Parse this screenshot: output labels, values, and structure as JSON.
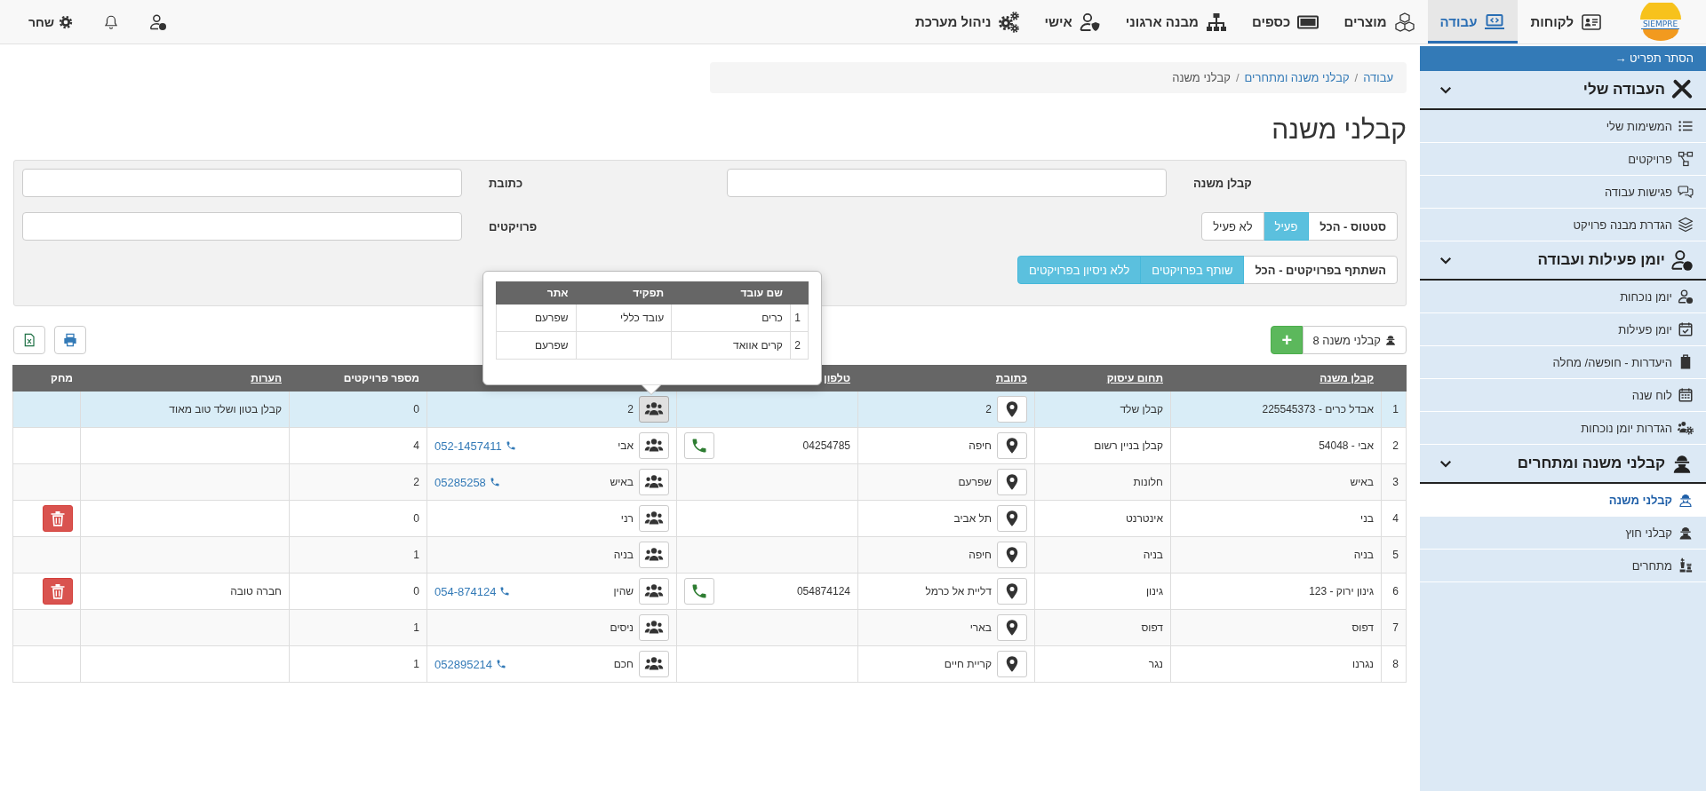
{
  "topbar": {
    "logo": "SIEMPRE",
    "nav": [
      {
        "label": "לקוחות",
        "selected": false
      },
      {
        "label": "עבודה",
        "selected": true
      },
      {
        "label": "מוצרים",
        "selected": false
      },
      {
        "label": "כספים",
        "selected": false
      },
      {
        "label": "מבנה ארגוני",
        "selected": false
      },
      {
        "label": "אישי",
        "selected": false
      },
      {
        "label": "ניהול מערכת",
        "selected": false
      }
    ],
    "user": "שחר"
  },
  "sidebar": {
    "hide_menu": "הסתר תפריט →",
    "groups": [
      {
        "title": "העבודה שלי",
        "expanded": true,
        "items": [
          {
            "label": "המשימות שלי",
            "selected": false
          },
          {
            "label": "פרויקטים",
            "selected": false
          },
          {
            "label": "פגישות עבודה",
            "selected": false
          },
          {
            "label": "הגדרת מבנה פרויקט",
            "selected": false
          }
        ]
      },
      {
        "title": "יומן פעילות ועבודה",
        "expanded": true,
        "items": [
          {
            "label": "יומן נוכחות",
            "selected": false
          },
          {
            "label": "יומן פעילות",
            "selected": false
          },
          {
            "label": "היעדרות - חופשה/ מחלה",
            "selected": false
          },
          {
            "label": "לוח שנה",
            "selected": false
          },
          {
            "label": "הגדרות יומן נוכחות",
            "selected": false
          }
        ]
      },
      {
        "title": "קבלני משנה ומתחרים",
        "expanded": true,
        "items": [
          {
            "label": "קבלני משנה",
            "selected": true
          },
          {
            "label": "קבלני חוץ",
            "selected": false
          },
          {
            "label": "מתחרים",
            "selected": false
          }
        ]
      }
    ]
  },
  "breadcrumb": {
    "separator": "/",
    "items": [
      {
        "label": "עבודה",
        "current": false
      },
      {
        "label": "קבלני משנה ומתחרים",
        "current": false
      },
      {
        "label": "קבלני משנה",
        "current": true
      }
    ]
  },
  "title": "קבלני משנה",
  "filters": {
    "fields": [
      {
        "label": "קבלן משנה"
      },
      {
        "label": "כתובת"
      },
      {
        "label": "פרויקטים"
      }
    ],
    "status": {
      "label": "סטטוס - הכל",
      "options": [
        {
          "label": "פעיל",
          "selected": true
        },
        {
          "label": "לא פעיל",
          "selected": false
        }
      ]
    },
    "participation": {
      "label": "השתתף בפרויקטים - הכל",
      "options": [
        {
          "label": "שותף בפרויקטים",
          "selected": true
        },
        {
          "label": "ללא ניסיון בפרויקטים",
          "selected": true
        }
      ]
    }
  },
  "toolbar": {
    "count": "קבלני משנה 8",
    "add": "+"
  },
  "table": {
    "columns": [
      {
        "label": "קבלן משנה",
        "sortable": true
      },
      {
        "label": "תחום עיסוק",
        "sortable": true
      },
      {
        "label": "כתובת",
        "sortable": true
      },
      {
        "label": "טלפון",
        "sortable": true
      },
      {},
      {
        "label": "מספר פרויקטים",
        "sortable": false
      },
      {
        "label": "הערות",
        "sortable": true
      },
      {
        "label": "מחק",
        "sortable": false
      }
    ],
    "rows": [
      {
        "num": "1",
        "name": "אבדל כרים - 225545373",
        "field": "קבלן שלד",
        "address": "2",
        "contact": "2",
        "contacts_open": true,
        "projects": "0",
        "notes": "קבלן בטון ושלד טוב מאוד",
        "deletable": false,
        "selected": true
      },
      {
        "num": "2",
        "name": "אבי - 54048",
        "field": "קבלן בניין רשום",
        "address": "חיפה",
        "phone": "04254785",
        "contact": "אבי",
        "contacts_open": false,
        "mobile": "052-1457411",
        "projects": "4",
        "deletable": false,
        "selected": false
      },
      {
        "num": "3",
        "name": "באיש",
        "field": "חלונות",
        "address": "שפרעם",
        "contact": "באיש",
        "contacts_open": false,
        "mobile": "05285258",
        "projects": "2",
        "deletable": false,
        "selected": false
      },
      {
        "num": "4",
        "name": "בני",
        "field": "אינטרנט",
        "address": "תל אביב",
        "contact": "רני",
        "contacts_open": false,
        "projects": "0",
        "deletable": true,
        "selected": false
      },
      {
        "num": "5",
        "name": "בניה",
        "field": "בניה",
        "address": "חיפה",
        "contact": "בניה",
        "contacts_open": false,
        "projects": "1",
        "deletable": false,
        "selected": false
      },
      {
        "num": "6",
        "name": "גינון ירוק - 123",
        "field": "גינון",
        "address": "דליית אל כרמל",
        "phone": "054874124",
        "contact": "שהין",
        "contacts_open": false,
        "mobile": "054-874124",
        "projects": "0",
        "notes": "חברה טובה",
        "deletable": true,
        "selected": false
      },
      {
        "num": "7",
        "name": "דפוס",
        "field": "דפוס",
        "address": "בארי",
        "contact": "ניסים",
        "contacts_open": false,
        "projects": "1",
        "deletable": false,
        "selected": false
      },
      {
        "num": "8",
        "name": "נגרנו",
        "field": "נגר",
        "address": "קריית חיים",
        "contact": "חכם",
        "contacts_open": false,
        "mobile": "052895214",
        "projects": "1",
        "deletable": false,
        "selected": false
      }
    ]
  },
  "popover": {
    "columns": [
      "שם עובד",
      "תפקיד",
      "אתר"
    ],
    "rows": [
      {
        "num": "1",
        "name": "כרים",
        "role": "עובד כללי",
        "site": "שפרעם"
      },
      {
        "num": "2",
        "name": "קרים אוואד",
        "site": "שפרעם"
      }
    ]
  }
}
